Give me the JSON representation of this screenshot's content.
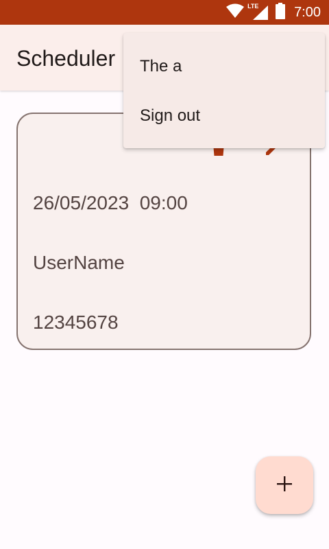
{
  "status_bar": {
    "time": "7:00",
    "network_label": "LTE",
    "color": "#AE360E",
    "icons": [
      "wifi-icon",
      "lte-signal-icon",
      "battery-icon"
    ]
  },
  "app_bar": {
    "title": "Scheduler",
    "background": "#FBEEEB"
  },
  "overflow_menu": {
    "items": [
      {
        "label": "The a"
      },
      {
        "label": "Sign out"
      }
    ]
  },
  "appointment_card": {
    "datetime": "26/05/2023  09:00",
    "username": "UserName",
    "phone": "12345678",
    "action_icons": [
      "delete-icon",
      "edit-icon"
    ],
    "accent_color": "#AE360E"
  },
  "fab": {
    "icon": "plus-icon",
    "background": "#FFDBD0"
  }
}
